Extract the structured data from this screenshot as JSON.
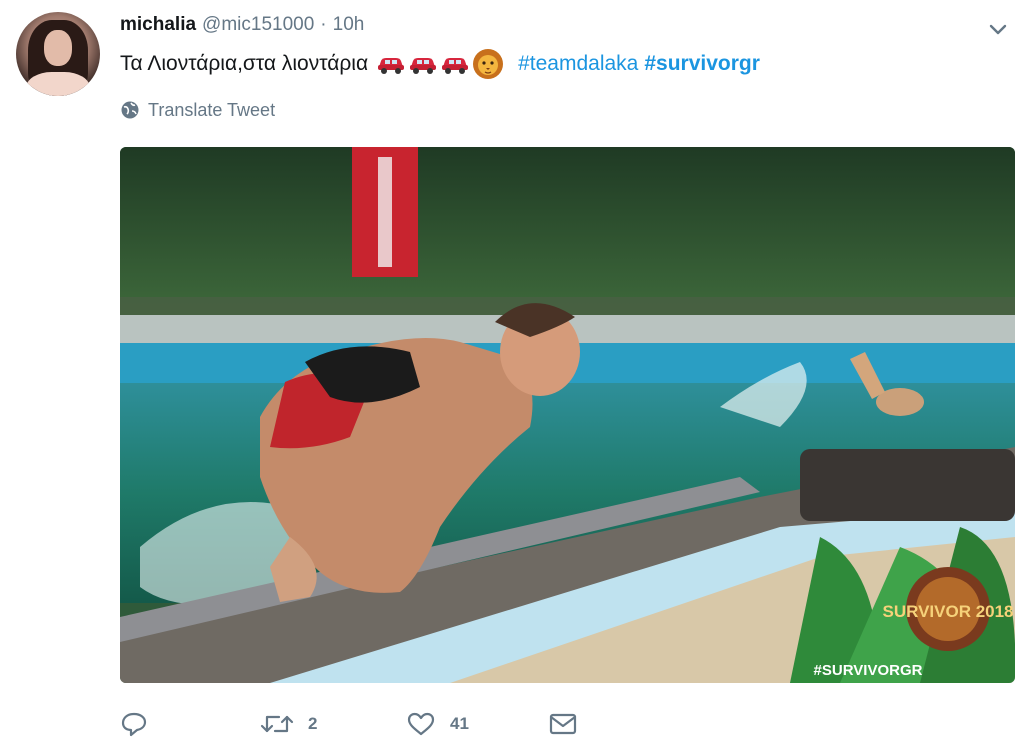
{
  "tweet": {
    "display_name": "michalia",
    "handle": "@mic151000",
    "separator": "·",
    "time": "10h",
    "text": "Τα Λιοντάρια,στα λιοντάρια",
    "hashtags": [
      "#teamdalaka",
      "#survivorgr"
    ],
    "emojis": [
      "red-car-icon",
      "red-car-icon",
      "red-car-icon",
      "lion-face-icon"
    ],
    "translate_label": "Translate Tweet"
  },
  "media": {
    "watermark_logo_text": "SURVIVOR 2018",
    "watermark_hashtag": "#SURVIVORGR"
  },
  "actions": {
    "reply_count": "",
    "retweet_count": "2",
    "like_count": "41"
  },
  "colors": {
    "link": "#1b95e0",
    "secondary_text": "#657786",
    "primary_text": "#14171a"
  }
}
